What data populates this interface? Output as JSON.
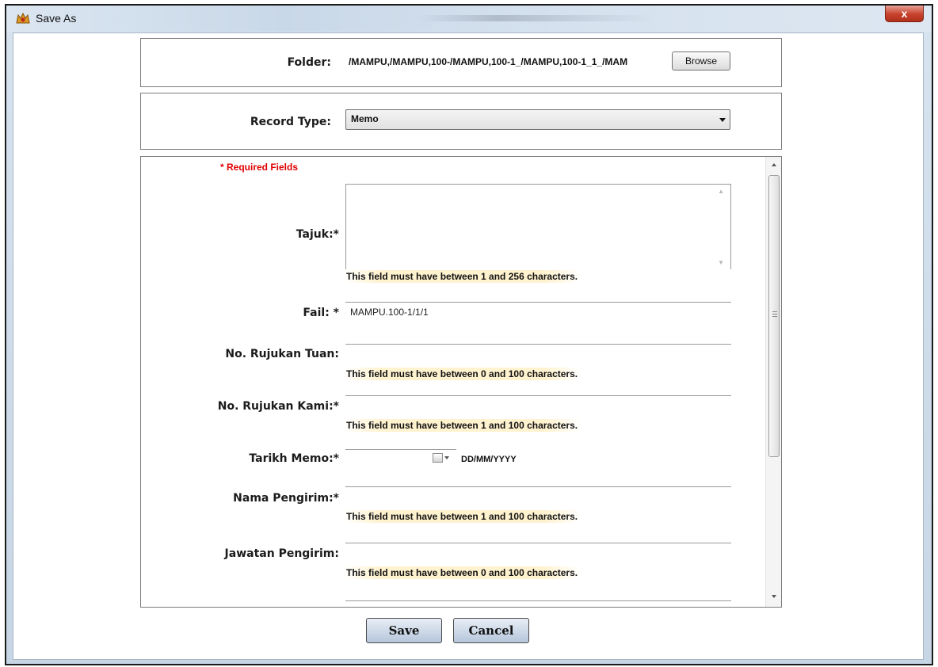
{
  "window": {
    "title": "Save As",
    "close_label": "x"
  },
  "folder": {
    "label": "Folder:",
    "path": "/MAMPU,/MAMPU,100-/MAMPU,100-1_/MAMPU,100-1_1_/MAM",
    "browse_label": "Browse"
  },
  "record_type": {
    "label": "Record Type:",
    "value": "Memo"
  },
  "form": {
    "required_note": "* Required Fields",
    "fields": [
      {
        "label": "Tajuk:*",
        "value": "",
        "hint": "This field must have between 1 and 256 characters."
      },
      {
        "label": "Fail: *",
        "value": "MAMPU.100-1/1/1",
        "hint": ""
      },
      {
        "label": "No. Rujukan Tuan:",
        "value": "",
        "hint": "This field must have between 0 and 100 characters."
      },
      {
        "label": "No. Rujukan Kami:*",
        "value": "",
        "hint": "This field must have between 1 and 100 characters."
      },
      {
        "label": "Tarikh Memo:*",
        "value": "",
        "hint": "DD/MM/YYYY"
      },
      {
        "label": "Nama Pengirim:*",
        "value": "",
        "hint": "This field must have between 1 and 100 characters."
      },
      {
        "label": "Jawatan Pengirim:",
        "value": "",
        "hint": "This field must have between 0 and 100 characters."
      }
    ]
  },
  "actions": {
    "save_label": "Save",
    "cancel_label": "Cancel"
  }
}
